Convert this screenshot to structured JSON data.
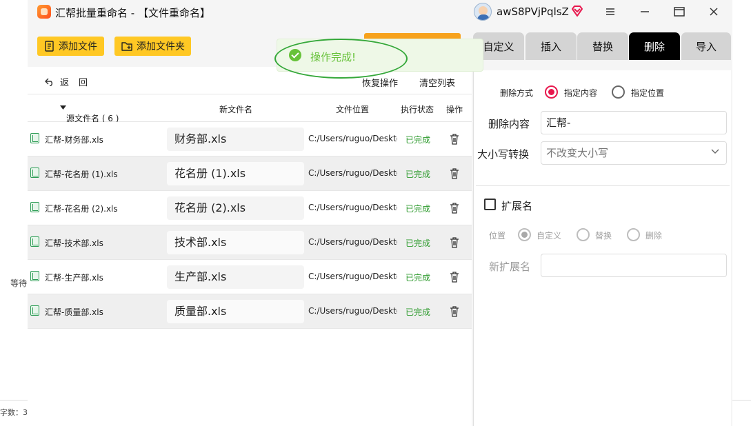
{
  "background": {
    "left_text": "等待",
    "bottom_text": "字数：3"
  },
  "titlebar": {
    "title": "汇帮批量重命名 - 【文件重命名】",
    "username": "awS8PVjPqlsZ"
  },
  "toolbar": {
    "add_file": "添加文件",
    "add_folder": "添加文件夹"
  },
  "toast": {
    "message": "操作完成!"
  },
  "mode_tabs": [
    {
      "label": "自定义",
      "active": false
    },
    {
      "label": "插入",
      "active": false
    },
    {
      "label": "替换",
      "active": false
    },
    {
      "label": "删除",
      "active": true
    },
    {
      "label": "导入",
      "active": false
    }
  ],
  "list": {
    "back": "返回",
    "restore": "恢复操作",
    "clear": "清空列表",
    "headers": {
      "source": "源文件名 ( 6 )",
      "new_name": "新文件名",
      "location": "文件位置",
      "status": "执行状态",
      "action": "操作"
    },
    "rows": [
      {
        "source": "汇帮-财务部.xls",
        "new_name": "财务部.xls",
        "path": "C:/Users/ruguo/Desktop",
        "status": "已完成"
      },
      {
        "source": "汇帮-花名册 (1).xls",
        "new_name": "花名册 (1).xls",
        "path": "C:/Users/ruguo/Desktop",
        "status": "已完成"
      },
      {
        "source": "汇帮-花名册 (2).xls",
        "new_name": "花名册 (2).xls",
        "path": "C:/Users/ruguo/Desktop",
        "status": "已完成"
      },
      {
        "source": "汇帮-技术部.xls",
        "new_name": "技术部.xls",
        "path": "C:/Users/ruguo/Desktop",
        "status": "已完成"
      },
      {
        "source": "汇帮-生产部.xls",
        "new_name": "生产部.xls",
        "path": "C:/Users/ruguo/Desktop",
        "status": "已完成"
      },
      {
        "source": "汇帮-质量部.xls",
        "new_name": "质量部.xls",
        "path": "C:/Users/ruguo/Desktop",
        "status": "已完成"
      }
    ]
  },
  "panel": {
    "delete_mode_label": "删除方式",
    "delete_mode_options": [
      "指定内容",
      "指定位置"
    ],
    "delete_mode_selected": "指定内容",
    "content_label": "删除内容",
    "content_value": "汇帮-",
    "case_label": "大小写转换",
    "case_value": "不改变大小写",
    "extension_label": "扩展名",
    "extension_checked": false,
    "position_label": "位置",
    "position_options": [
      "自定义",
      "替换",
      "删除"
    ],
    "position_selected": "自定义",
    "new_ext_label": "新扩展名"
  },
  "colors": {
    "accent_yellow": "#ffc824",
    "active_tab": "#000000",
    "radio_selected": "#e8174d",
    "status_done": "#2e9b2e",
    "toast_green": "#67c23a"
  }
}
